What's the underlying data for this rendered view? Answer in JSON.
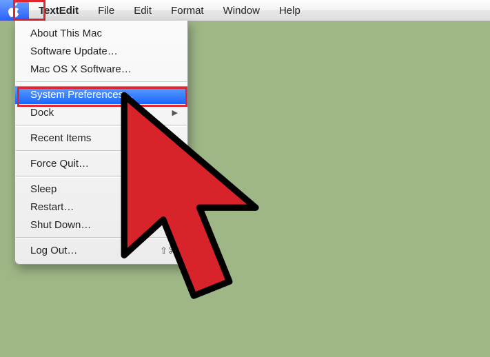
{
  "menubar": {
    "app": "TextEdit",
    "items": [
      "File",
      "Edit",
      "Format",
      "Window",
      "Help"
    ]
  },
  "apple_menu": {
    "about": {
      "label": "About This Mac"
    },
    "update": {
      "label": "Software Update…"
    },
    "software": {
      "label": "Mac OS X Software…"
    },
    "sysprefs": {
      "label": "System Preferences…"
    },
    "dock": {
      "label": "Dock"
    },
    "recent": {
      "label": "Recent Items"
    },
    "forcequit": {
      "label": "Force Quit…"
    },
    "sleep": {
      "label": "Sleep"
    },
    "restart": {
      "label": "Restart…"
    },
    "shutdown": {
      "label": "Shut Down…"
    },
    "logout": {
      "label": "Log Out…",
      "shortcut": "⇧⌘"
    }
  },
  "colors": {
    "desktop": "#9fb787",
    "highlight": "#2a6bff",
    "callout": "#e0262f"
  }
}
